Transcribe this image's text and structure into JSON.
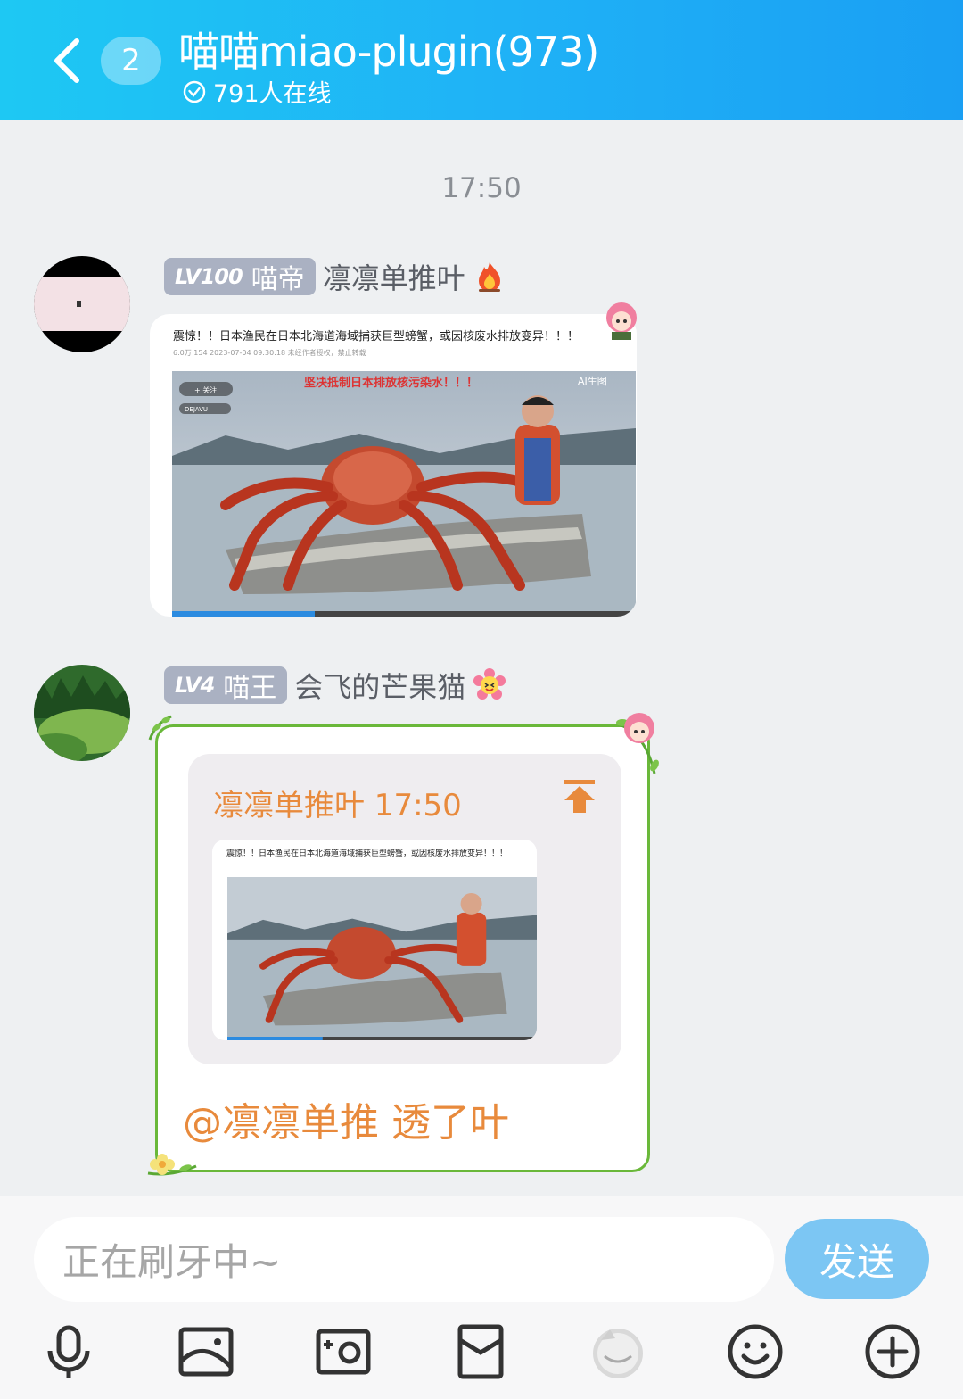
{
  "header": {
    "unread_count": "2",
    "group_title": "喵喵miao-plugin(973)",
    "online_text": "791人在线"
  },
  "chat": {
    "timestamp": "17:50",
    "messages": [
      {
        "level": "LV100",
        "rank_title": "喵帝",
        "nickname": "凛凛单推叶",
        "image": {
          "title": "震惊！！日本渔民在日本北海道海域捕获巨型螃蟹，或因核废水排放变异！！！",
          "meta": "6.0万  154  2023-07-04 09:30:18  未经作者授权，禁止转载",
          "overlay_caption": "坚决抵制日本排放核污染水！！！",
          "ai_tag": "AI生图",
          "follow": "+ 关注",
          "music": "DEJAVU"
        }
      },
      {
        "level": "LV4",
        "rank_title": "喵王",
        "nickname": "会飞的芒果猫",
        "quote": {
          "header": "凛凛单推叶 17:50"
        },
        "reply": "@凛凛单推 透了叶"
      }
    ]
  },
  "input": {
    "placeholder": "正在刷牙中~",
    "send_label": "发送"
  },
  "toolbar": [
    "microphone-icon",
    "image-icon",
    "camera-icon",
    "red-packet-icon",
    "sticker-icon",
    "emoji-icon",
    "plus-icon"
  ],
  "colors": {
    "header_gradient_start": "#1ec8f3",
    "header_gradient_end": "#1a9ff3",
    "badge": "#aab1c2",
    "quote_orange": "#e88a3c",
    "vine_green": "#6ab83a",
    "send_blue": "#7cc6f3"
  }
}
